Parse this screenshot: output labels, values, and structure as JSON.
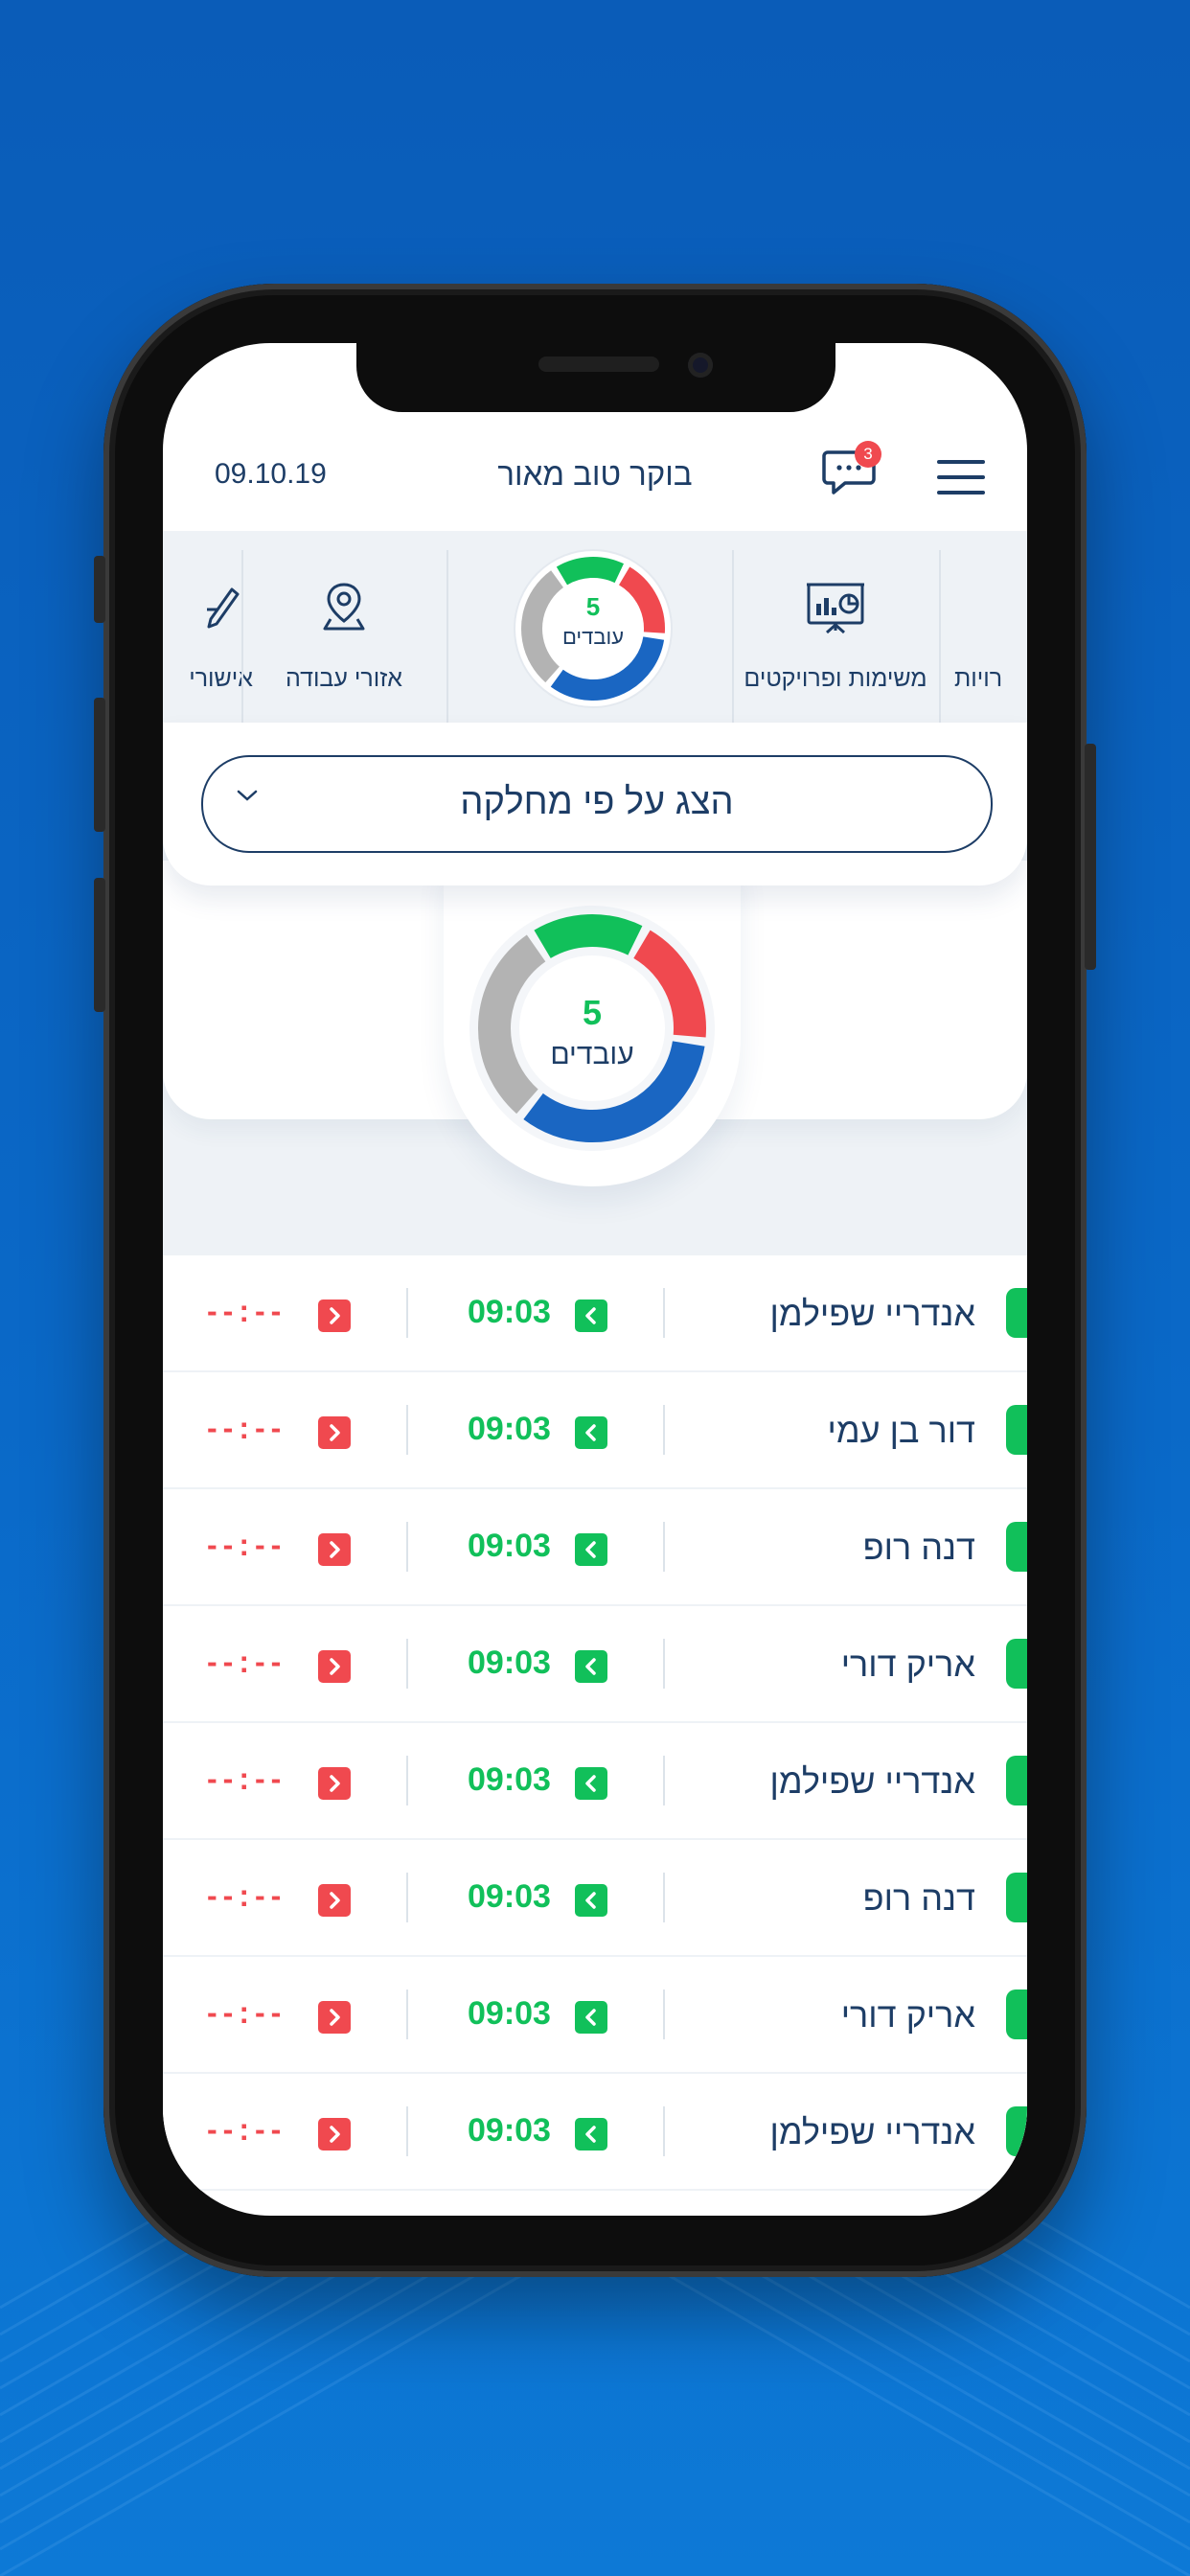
{
  "header": {
    "date": "09.10.19",
    "greeting": "בוקר טוב מאור",
    "notification_count": "3"
  },
  "categories": [
    {
      "label": "אישורי",
      "icon": "pen-icon"
    },
    {
      "label": "אזורי עבודה",
      "icon": "location-pin-icon"
    },
    {
      "label": "משימות ופרויקטים",
      "icon": "presentation-board-icon"
    },
    {
      "label": "רויות",
      "icon": "person-icon"
    }
  ],
  "mini_donut": {
    "count": "5",
    "label": "עובדים"
  },
  "filter": {
    "label": "הצג על פי מחלקה"
  },
  "summary": {
    "count": "5",
    "label": "עובדים",
    "segments": [
      {
        "name": "green",
        "color": "#11c05a",
        "fraction": 0.17
      },
      {
        "name": "red",
        "color": "#f0494f",
        "fraction": 0.19
      },
      {
        "name": "blue",
        "color": "#1a66c2",
        "fraction": 0.34
      },
      {
        "name": "gray",
        "color": "#b3b3b3",
        "fraction": 0.3
      }
    ]
  },
  "employees": [
    {
      "name": "אנדריי שפילמן",
      "in": "09:03",
      "out": "--:--"
    },
    {
      "name": "דור בן עמי",
      "in": "09:03",
      "out": "--:--"
    },
    {
      "name": "דנה רופ",
      "in": "09:03",
      "out": "--:--"
    },
    {
      "name": "אריק דורי",
      "in": "09:03",
      "out": "--:--"
    },
    {
      "name": "אנדריי שפילמן",
      "in": "09:03",
      "out": "--:--"
    },
    {
      "name": "דנה רופ",
      "in": "09:03",
      "out": "--:--"
    },
    {
      "name": "אריק דורי",
      "in": "09:03",
      "out": "--:--"
    },
    {
      "name": "אנדריי שפילמן",
      "in": "09:03",
      "out": "--:--"
    }
  ],
  "colors": {
    "background": "#0a65c4",
    "navy": "#1d3d66",
    "green": "#11c05a",
    "red": "#f0494f",
    "blue": "#1a66c2",
    "gray": "#b3b3b3"
  }
}
